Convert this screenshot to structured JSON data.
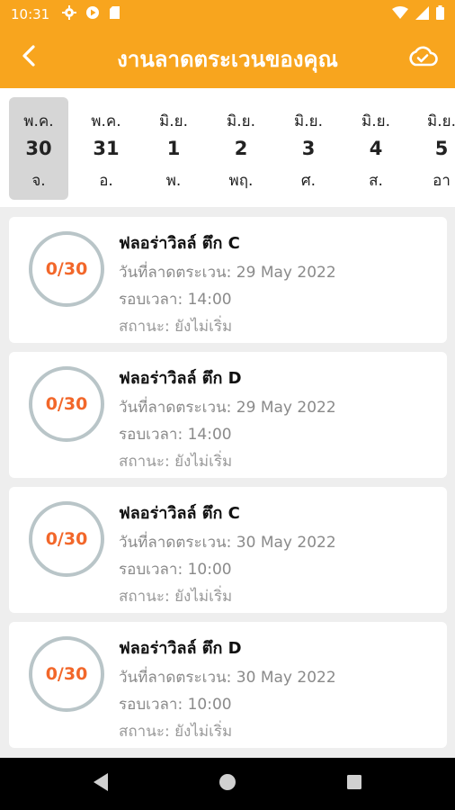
{
  "status": {
    "time": "10:31"
  },
  "header": {
    "title": "งานลาดตระเวนของคุณ"
  },
  "dates": [
    {
      "month": "พ.ค.",
      "day": "30",
      "weekday": "จ.",
      "selected": true
    },
    {
      "month": "พ.ค.",
      "day": "31",
      "weekday": "อ.",
      "selected": false
    },
    {
      "month": "มิ.ย.",
      "day": "1",
      "weekday": "พ.",
      "selected": false
    },
    {
      "month": "มิ.ย.",
      "day": "2",
      "weekday": "พฤ.",
      "selected": false
    },
    {
      "month": "มิ.ย.",
      "day": "3",
      "weekday": "ศ.",
      "selected": false
    },
    {
      "month": "มิ.ย.",
      "day": "4",
      "weekday": "ส.",
      "selected": false
    },
    {
      "month": "มิ.ย.",
      "day": "5",
      "weekday": "อา",
      "selected": false
    }
  ],
  "patrols": [
    {
      "progress": "0/30",
      "name": "ฟลอร่าวิลล์ ตึก C",
      "date_line": "วันที่ลาดตระเวน: 29 May 2022",
      "time_line": "รอบเวลา: 14:00",
      "status_line": "สถานะ: ยังไม่เริ่ม"
    },
    {
      "progress": "0/30",
      "name": "ฟลอร่าวิลล์ ตึก D",
      "date_line": "วันที่ลาดตระเวน: 29 May 2022",
      "time_line": "รอบเวลา: 14:00",
      "status_line": "สถานะ: ยังไม่เริ่ม"
    },
    {
      "progress": "0/30",
      "name": "ฟลอร่าวิลล์ ตึก C",
      "date_line": "วันที่ลาดตระเวน: 30 May 2022",
      "time_line": "รอบเวลา: 10:00",
      "status_line": "สถานะ: ยังไม่เริ่ม"
    },
    {
      "progress": "0/30",
      "name": "ฟลอร่าวิลล์ ตึก D",
      "date_line": "วันที่ลาดตระเวน: 30 May 2022",
      "time_line": "รอบเวลา: 10:00",
      "status_line": "สถานะ: ยังไม่เริ่ม"
    }
  ],
  "colors": {
    "accent": "#f8a51e",
    "progress_text": "#f2672a",
    "ring": "#b9c5c8"
  },
  "icons": [
    "settings-icon",
    "play-icon",
    "sd-card-icon",
    "wifi-icon",
    "signal-icon",
    "battery-icon",
    "back-arrow-icon",
    "cloud-check-icon",
    "nav-back-icon",
    "nav-home-icon",
    "nav-recents-icon"
  ]
}
